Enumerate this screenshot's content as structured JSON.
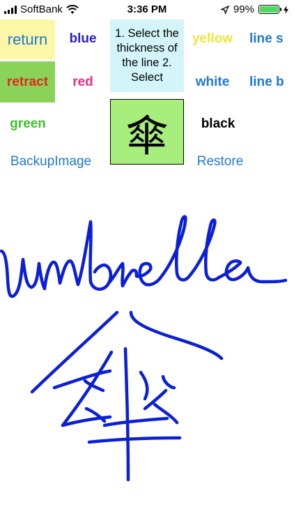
{
  "status_bar": {
    "carrier": "SoftBank",
    "time": "3:36 PM",
    "battery_percent": "99%",
    "battery_level": 0.99,
    "battery_color": "#4cd964",
    "icons": [
      "signal-bars-icon",
      "wifi-icon",
      "location-arrow-icon",
      "battery-icon",
      "charging-bolt-icon"
    ]
  },
  "buttons": {
    "return": "return",
    "retract": "retract",
    "blue": "blue",
    "red": "red",
    "green": "green",
    "yellow": "yellow",
    "white": "white",
    "line_s": "line s",
    "line_b": "line b",
    "black": "black",
    "backup": "BackupImage",
    "restore": "Restore"
  },
  "instructions": {
    "text": "1. Select the thickness of the line 2. Select"
  },
  "preview": {
    "character": "傘"
  },
  "colors": {
    "return_bg": "#fbf7a6",
    "retract_bg": "#8bd25a",
    "instructions_bg": "#d3f5f9",
    "preview_bg": "#a7ee7c",
    "ink": "#0a1fd6"
  }
}
